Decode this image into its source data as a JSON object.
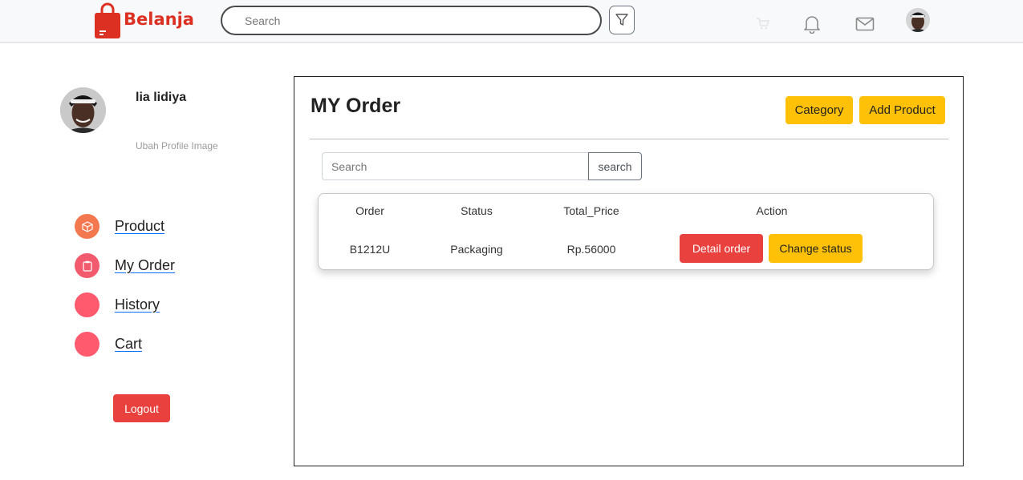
{
  "navbar": {
    "brand": "Belanja",
    "brand_color": "#db3022",
    "search_placeholder": "Search",
    "icons": [
      "filter-icon",
      "cart-icon",
      "bell-icon",
      "mail-icon",
      "avatar"
    ]
  },
  "profile": {
    "name": "lia lidiya",
    "edit_label": "Ubah Profile Image"
  },
  "sidebar": {
    "items": [
      {
        "label": "Product",
        "icon": "box-icon",
        "color": "#f3774f"
      },
      {
        "label": "My Order",
        "icon": "clipboard-icon",
        "color": "#f25a6d"
      },
      {
        "label": "History",
        "icon": "",
        "color": "#ff5a6e"
      },
      {
        "label": "Cart",
        "icon": "",
        "color": "#ff5a6e"
      }
    ],
    "logout_label": "Logout"
  },
  "main": {
    "title": "MY Order",
    "category_label": "Category",
    "add_product_label": "Add Product",
    "search_placeholder": "Search",
    "search_button": "search",
    "table": {
      "headers": [
        "Order",
        "Status",
        "Total_Price",
        "Action"
      ],
      "rows": [
        {
          "order": "B1212U",
          "status": "Packaging",
          "total": "Rp.56000",
          "detail_label": "Detail order",
          "change_label": "Change status"
        }
      ]
    }
  },
  "colors": {
    "danger": "#e9413e",
    "warning": "#ffc107"
  }
}
